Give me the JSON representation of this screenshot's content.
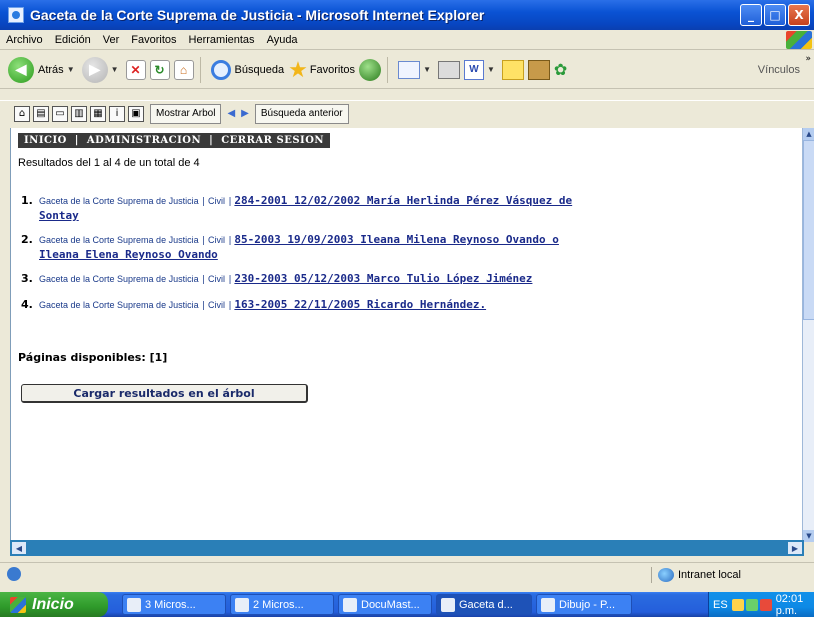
{
  "window": {
    "title": "Gaceta de la Corte Suprema de Justicia - Microsoft Internet Explorer",
    "min_label": "_",
    "max_label": "□",
    "close_label": "X"
  },
  "menu": {
    "items": [
      "Archivo",
      "Edición",
      "Ver",
      "Favoritos",
      "Herramientas",
      "Ayuda"
    ]
  },
  "toolbar": {
    "back_label": "Atrás",
    "search_label": "Búsqueda",
    "favorites_label": "Favoritos",
    "links_label": "Vínculos",
    "icons": [
      "back-icon",
      "forward-icon",
      "stop-icon",
      "refresh-icon",
      "home-icon",
      "search-icon",
      "favorites-icon",
      "media-icon",
      "mail-icon",
      "print-icon",
      "word-icon",
      "notes-icon",
      "book-icon",
      "messenger-icon"
    ]
  },
  "toolbar2": {
    "show_tree_label": "Mostrar Arbol",
    "prev_search_label": "Búsqueda anterior"
  },
  "nav": {
    "items": [
      "INICIO",
      "ADMINISTRACION",
      "CERRAR SESION"
    ]
  },
  "results": {
    "summary": "Resultados del 1 al 4 de un total de 4",
    "items": [
      {
        "num": "1.",
        "source": "Gaceta de la Corte Suprema de Justicia",
        "category": "Civil",
        "title": "284-2001 12/02/2002 María Herlinda Pérez Vásquez de Sontay"
      },
      {
        "num": "2.",
        "source": "Gaceta de la Corte Suprema de Justicia",
        "category": "Civil",
        "title": "85-2003 19/09/2003 Ileana Milena Reynoso Ovando o Ileana Elena Reynoso Ovando"
      },
      {
        "num": "3.",
        "source": "Gaceta de la Corte Suprema de Justicia",
        "category": "Civil",
        "title": "230-2003 05/12/2003 Marco Tulio López Jiménez"
      },
      {
        "num": "4.",
        "source": "Gaceta de la Corte Suprema de Justicia",
        "category": "Civil",
        "title": "163-2005 22/11/2005 Ricardo Hernández."
      }
    ],
    "pages_label": "Páginas disponibles: [1]",
    "load_button": "Cargar resultados en el árbol"
  },
  "status": {
    "zone": "Intranet local"
  },
  "taskbar": {
    "start_label": "Inicio",
    "tasks": [
      "3 Micros...",
      "2 Micros...",
      "DocuMast...",
      "Gaceta d...",
      "Dibujo - P..."
    ],
    "lang": "ES",
    "clock": "02:01 p.m."
  },
  "colors": {
    "title_bar": "#0a53d4",
    "link": "#1a2a8a",
    "nav_bg": "#3a3a3a",
    "taskbar": "#245edb",
    "start_button": "#2e9a2a"
  }
}
